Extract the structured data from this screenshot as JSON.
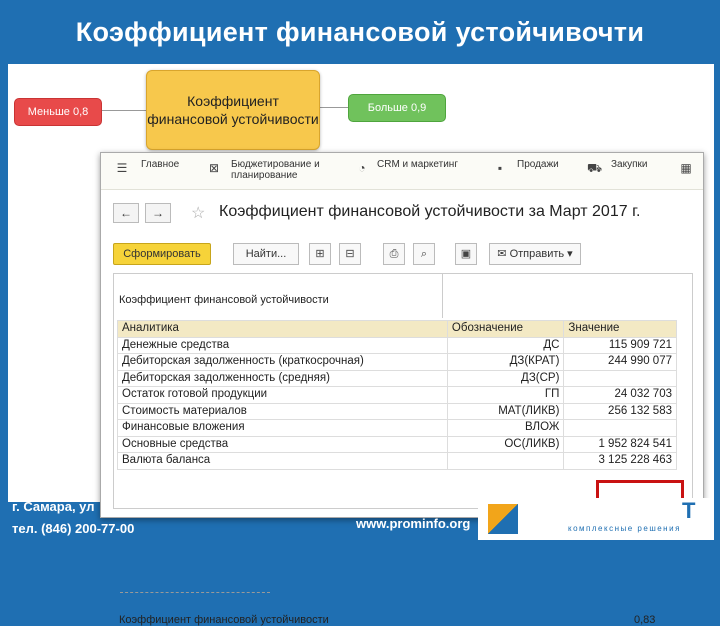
{
  "slide": {
    "title": "Коэффициент финансовой устойчивочти",
    "footer_address": "г. Самара, ул",
    "footer_phone": "тел. (846) 200-77-00",
    "footer_website": "www.prominfo.org",
    "logo_letter": "Т",
    "logo_tagline": "комплексные решения"
  },
  "diagram": {
    "less_label": "Меньше 0,8",
    "center_label": "Коэффициент финансовой устойчивости",
    "more_label": "Больше 0,9"
  },
  "app": {
    "menu": [
      {
        "label": "Главное",
        "icon": "menu-icon"
      },
      {
        "label": "Бюджетирование и планирование",
        "icon": "budget-icon"
      },
      {
        "label": "CRM и маркетинг",
        "icon": "crm-icon"
      },
      {
        "label": "Продажи",
        "icon": "bag-icon"
      },
      {
        "label": "Закупки",
        "icon": "cart-icon"
      }
    ],
    "doc_title": "Коэффициент финансовой устойчивости  за Март 2017 г.",
    "toolbar": {
      "generate_label": "Сформировать",
      "find_label": "Найти...",
      "send_label": "Отправить"
    },
    "report": {
      "heading": "Коэффициент финансовой устойчивости",
      "columns": [
        "Аналитика",
        "Обозначение",
        "Значение"
      ],
      "rows": [
        {
          "name": "Денежные средства",
          "code": "ДС",
          "value": "115 909 721"
        },
        {
          "name": "Дебиторская задолженность (краткосрочная)",
          "code": "ДЗ(КРАТ)",
          "value": "244 990 077"
        },
        {
          "name": "Дебиторская задолженность (средняя)",
          "code": "ДЗ(СР)",
          "value": ""
        },
        {
          "name": "Остаток готовой продукции",
          "code": "ГП",
          "value": "24 032 703"
        },
        {
          "name": "Стоимость материалов",
          "code": "МАТ(ЛИКВ)",
          "value": "256 132 583"
        },
        {
          "name": "Финансовые вложения",
          "code": "ВЛОЖ",
          "value": ""
        },
        {
          "name": "Основные средства",
          "code": "ОС(ЛИКВ)",
          "value": "1 952 824 541"
        },
        {
          "name": "Валюта баланса",
          "code": "",
          "value": "3 125 228 463"
        }
      ],
      "result_label": "Коэффициент финансовой устойчивости",
      "result_value": "0,83"
    }
  }
}
